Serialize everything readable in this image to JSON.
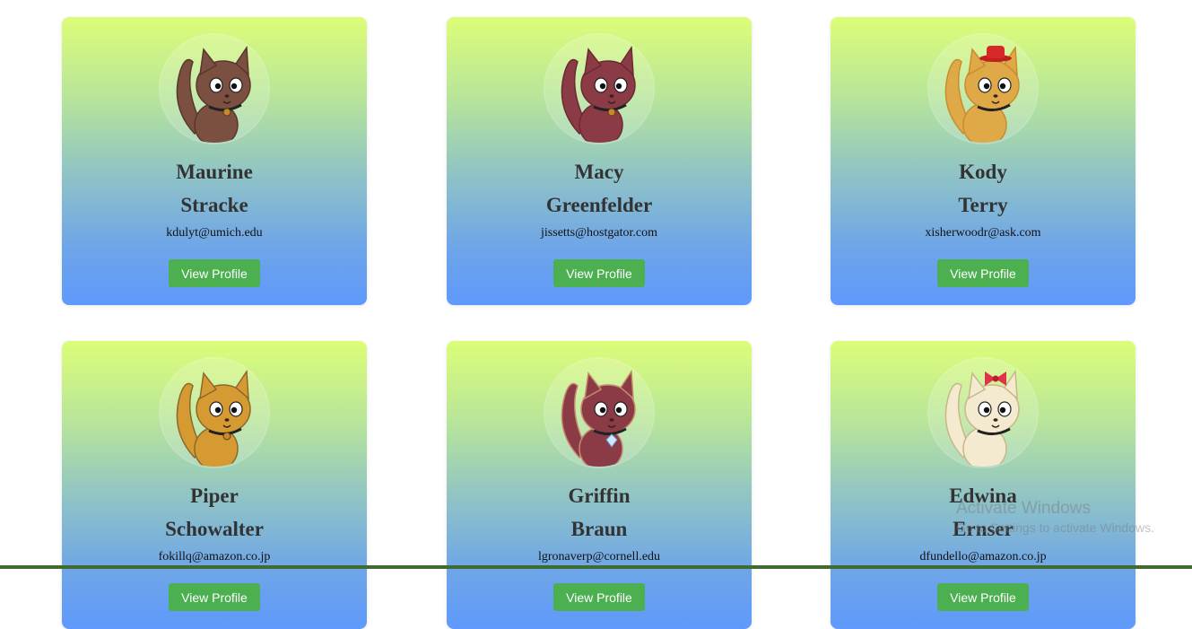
{
  "cards": [
    {
      "first": "Maurine",
      "last": "Stracke",
      "email": "kdulyt@umich.edu",
      "button": "View Profile",
      "avatar": "brown-cat-avatar",
      "fur": "#7b5040",
      "accent": "#5a372c"
    },
    {
      "first": "Macy",
      "last": "Greenfelder",
      "email": "jissetts@hostgator.com",
      "button": "View Profile",
      "avatar": "maroon-cat-avatar",
      "fur": "#8a3b45",
      "accent": "#6b2a33"
    },
    {
      "first": "Kody",
      "last": "Terry",
      "email": "xisherwoodr@ask.com",
      "button": "View Profile",
      "avatar": "orange-cat-with-red-hat-avatar",
      "fur": "#e0a948",
      "accent": "#c88d2e"
    },
    {
      "first": "Piper",
      "last": "Schowalter",
      "email": "fokillq@amazon.co.jp",
      "button": "View Profile",
      "avatar": "orange-cat-with-collar-avatar",
      "fur": "#d69a33",
      "accent": "#8a6a2a"
    },
    {
      "first": "Griffin",
      "last": "Braun",
      "email": "lgronaverp@cornell.edu",
      "button": "View Profile",
      "avatar": "maroon-cat-with-gem-avatar",
      "fur": "#8a3b45",
      "accent": "#c58a6e"
    },
    {
      "first": "Edwina",
      "last": "Ernser",
      "email": "dfundello@amazon.co.jp",
      "button": "View Profile",
      "avatar": "cream-cat-with-bow-avatar",
      "fur": "#f3ead0",
      "accent": "#c9b68a"
    }
  ],
  "watermark": {
    "title": "Activate Windows",
    "subtitle": "Go to Settings to activate Windows."
  },
  "colors": {
    "button": "#4caf50",
    "gradient_top": "#dcfd78",
    "gradient_bottom": "#5f99fb",
    "name_text": "#333333"
  }
}
